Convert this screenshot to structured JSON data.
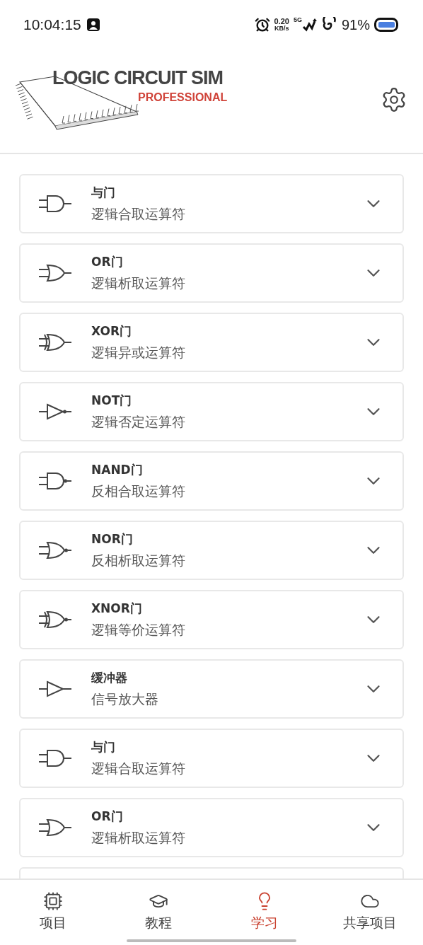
{
  "status_bar": {
    "time": "10:04:15",
    "speed_value": "0.20",
    "speed_unit": "KB/s",
    "network": "5G",
    "battery": "91%"
  },
  "header": {
    "logo_title": "LOGIC CIRCUIT SIM",
    "logo_subtitle": "PROFESSIONAL"
  },
  "gates": [
    {
      "kind": "and",
      "name": "与门",
      "description": "逻辑合取运算符",
      "expanded": false
    },
    {
      "kind": "or",
      "name": "OR门",
      "description": "逻辑析取运算符",
      "expanded": false
    },
    {
      "kind": "xor",
      "name": "XOR门",
      "description": "逻辑异或运算符",
      "expanded": false
    },
    {
      "kind": "not",
      "name": "NOT门",
      "description": "逻辑否定运算符",
      "expanded": false
    },
    {
      "kind": "nand",
      "name": "NAND门",
      "description": "反相合取运算符",
      "expanded": false
    },
    {
      "kind": "nor",
      "name": "NOR门",
      "description": "反相析取运算符",
      "expanded": false
    },
    {
      "kind": "xnor",
      "name": "XNOR门",
      "description": "逻辑等价运算符",
      "expanded": false
    },
    {
      "kind": "buffer",
      "name": "缓冲器",
      "description": "信号放大器",
      "expanded": false
    },
    {
      "kind": "and",
      "name": "与门",
      "description": "逻辑合取运算符",
      "expanded": false
    },
    {
      "kind": "or",
      "name": "OR门",
      "description": "逻辑析取运算符",
      "expanded": false
    }
  ],
  "bottom_nav": [
    {
      "kind": "chip",
      "label": "项目",
      "selected": false
    },
    {
      "kind": "cap",
      "label": "教程",
      "selected": false
    },
    {
      "kind": "bulb",
      "label": "学习",
      "selected": true
    },
    {
      "kind": "cloud",
      "label": "共享项目",
      "selected": false
    }
  ]
}
